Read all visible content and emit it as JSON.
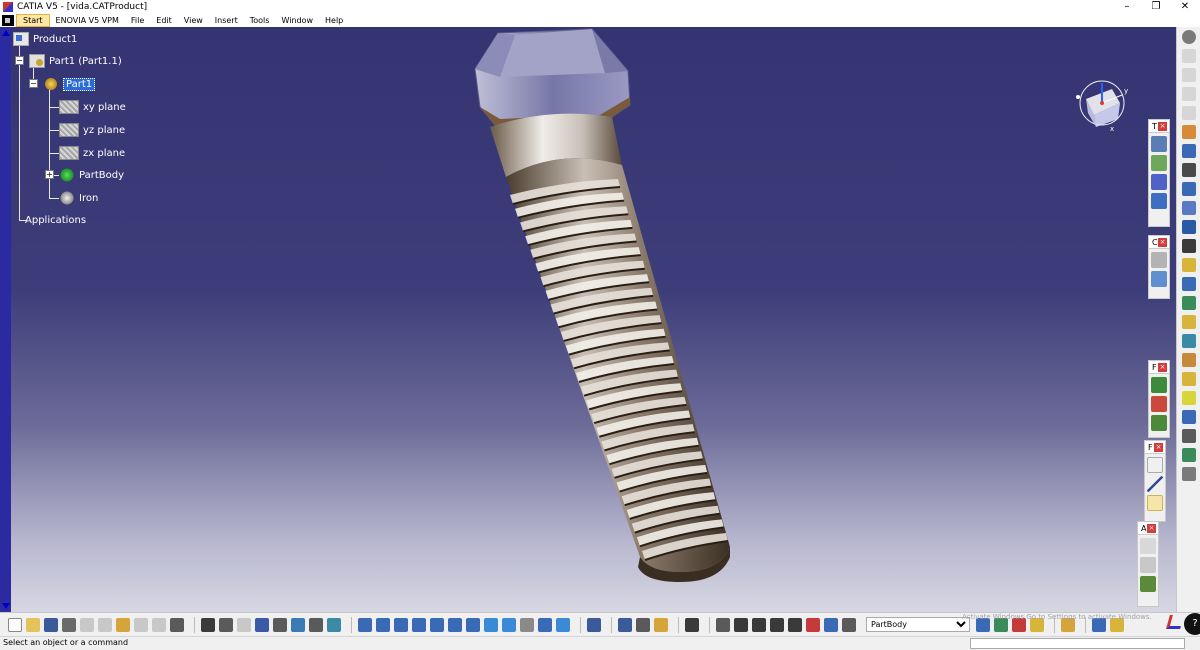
{
  "window": {
    "title": "CATIA V5 - [vida.CATProduct]",
    "minimize": "–",
    "maximize": "❐",
    "close": "✕"
  },
  "menu": [
    "Start",
    "ENOVIA V5 VPM",
    "File",
    "Edit",
    "View",
    "Insert",
    "Tools",
    "Window",
    "Help"
  ],
  "tree": {
    "product": "Product1",
    "part_instance": "Part1 (Part1.1)",
    "part": "Part1",
    "xy_plane": "xy plane",
    "yz_plane": "yz plane",
    "zx_plane": "zx plane",
    "part_body": "PartBody",
    "material": "Iron",
    "applications": "Applications"
  },
  "compass": {
    "x_label": "x",
    "y_label": "y"
  },
  "toolbars": {
    "t_header": "T",
    "c_header": "C",
    "f_header": "F",
    "f2_header": "F",
    "a_header": "A"
  },
  "bottom": {
    "current_body": "PartBody",
    "watermark": "Activate Windows Go to Settings to activate Windows.",
    "help_icon": "?"
  },
  "status": {
    "message": "Select an object or a command",
    "command_input": ""
  },
  "colors": {
    "viewport_top": "#353472",
    "viewport_bottom": "#d7d7e3",
    "selection": "#2a6bd8",
    "bolt_body": "#7a6a5a"
  }
}
